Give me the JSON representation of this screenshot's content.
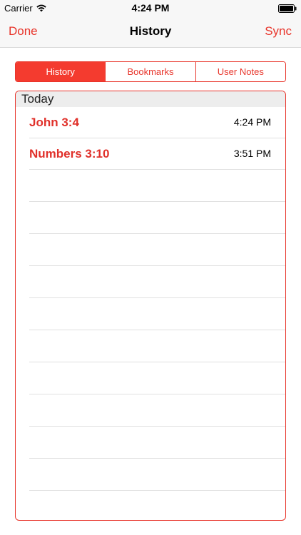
{
  "status_bar": {
    "carrier": "Carrier",
    "time": "4:24 PM"
  },
  "nav": {
    "left_label": "Done",
    "title": "History",
    "right_label": "Sync"
  },
  "segments": [
    {
      "label": "History",
      "selected": true
    },
    {
      "label": "Bookmarks",
      "selected": false
    },
    {
      "label": "User Notes",
      "selected": false
    }
  ],
  "history": {
    "section_title": "Today",
    "items": [
      {
        "reference": "John 3:4",
        "time": "4:24 PM"
      },
      {
        "reference": "Numbers 3:10",
        "time": "3:51 PM"
      }
    ]
  },
  "colors": {
    "accent": "#e8352b",
    "selected_segment": "#f43b2f"
  }
}
